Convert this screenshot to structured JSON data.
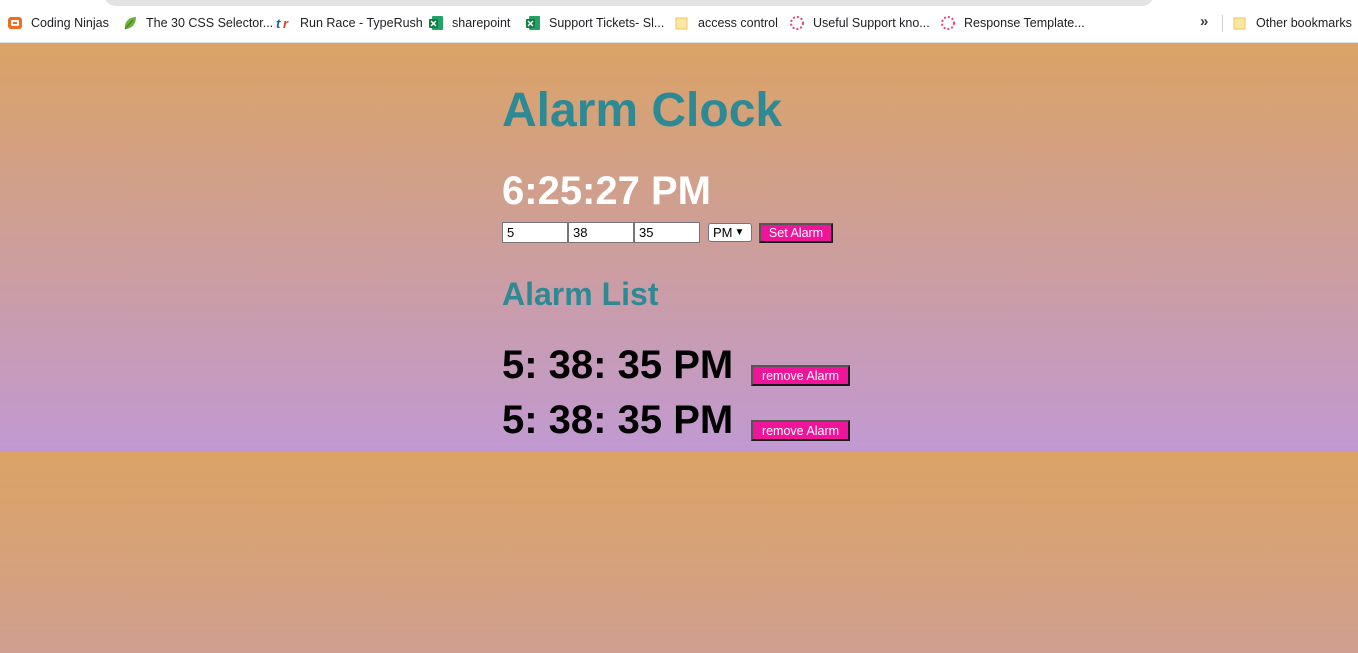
{
  "bookmarks": {
    "items": [
      {
        "label": "Coding Ninjas",
        "icon": "coding-ninjas-icon"
      },
      {
        "label": "The 30 CSS Selector...",
        "icon": "leaf-icon"
      },
      {
        "label": "Run Race - TypeRush",
        "icon": "typerush-icon"
      },
      {
        "label": "sharepoint",
        "icon": "excel-icon"
      },
      {
        "label": "Support Tickets- Sl...",
        "icon": "excel-icon"
      },
      {
        "label": "access control",
        "icon": "folder-icon"
      },
      {
        "label": "Useful Support kno...",
        "icon": "loading-spinner-icon"
      },
      {
        "label": "Response Template...",
        "icon": "loading-spinner-icon"
      }
    ],
    "more": "»",
    "other": "Other bookmarks"
  },
  "app": {
    "title": "Alarm Clock",
    "clock": "6:25:27 PM",
    "inputs": {
      "hour": "5",
      "minute": "38",
      "second": "35",
      "ampm": "PM"
    },
    "set_button": "Set Alarm",
    "list_title": "Alarm List",
    "alarms": [
      {
        "time": "5: 38: 35 PM",
        "remove": "remove Alarm"
      },
      {
        "time": "5: 38: 35 PM",
        "remove": "remove Alarm"
      }
    ]
  },
  "colors": {
    "accent_teal": "#2d8a95",
    "button_pink": "#f0149a",
    "bg_orange": "#dba366",
    "bg_lavender": "#c199d2"
  }
}
